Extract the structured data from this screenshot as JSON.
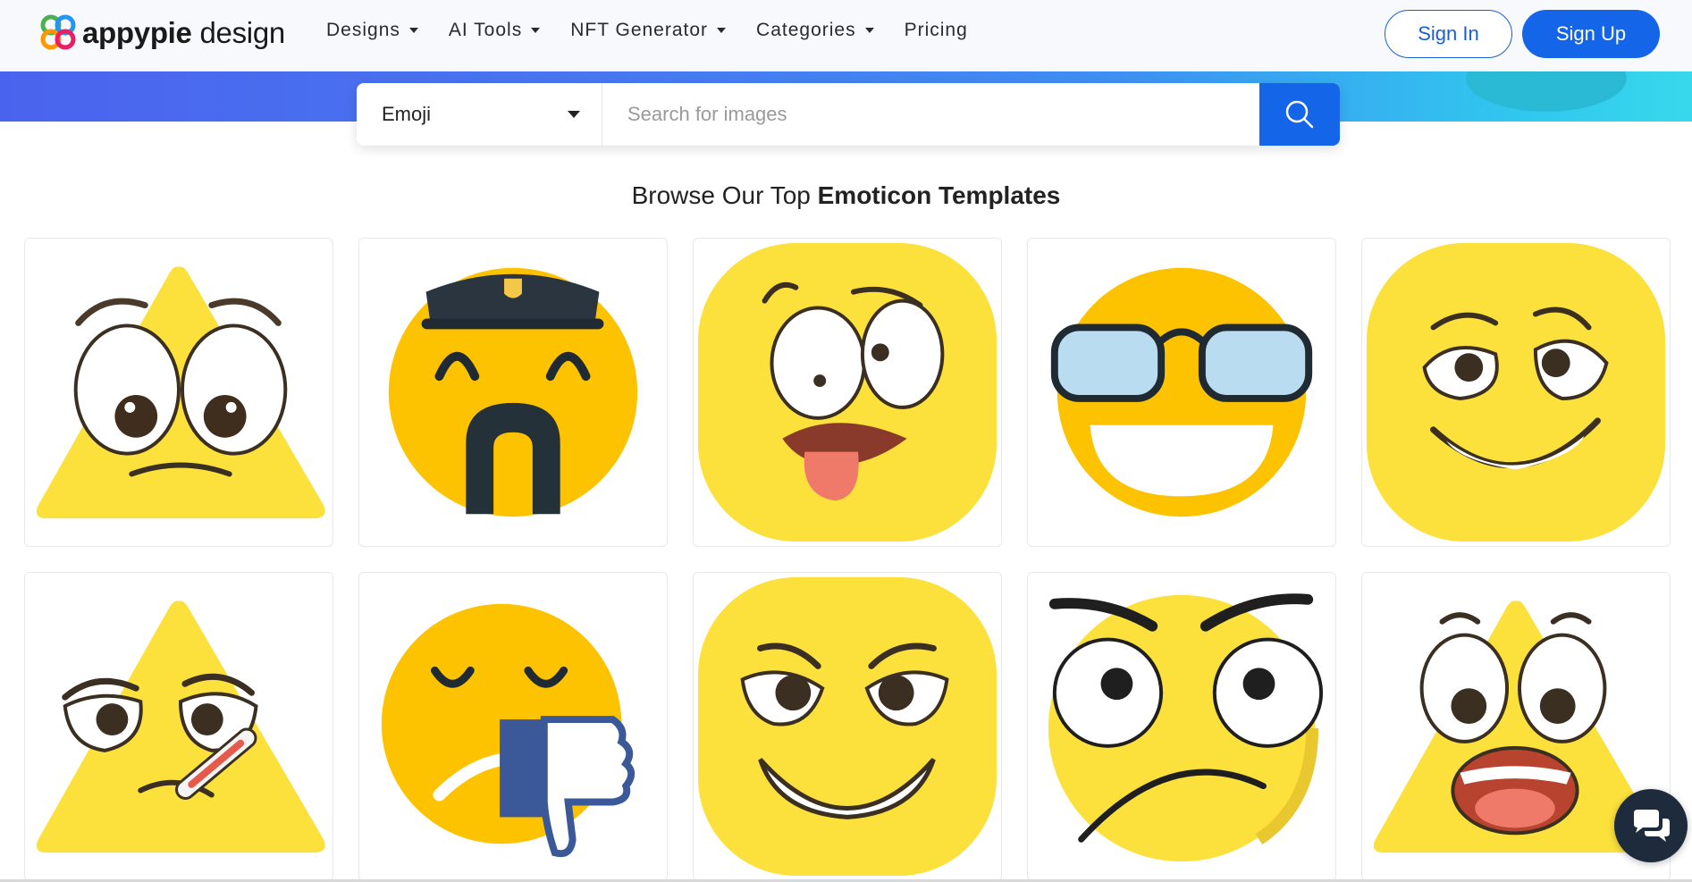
{
  "brand": {
    "name_bold": "appypie",
    "name_rest": " design"
  },
  "nav": [
    {
      "label": "Designs",
      "has_caret": true
    },
    {
      "label": "AI Tools",
      "has_caret": true
    },
    {
      "label": "NFT Generator",
      "has_caret": true
    },
    {
      "label": "Categories",
      "has_caret": true
    },
    {
      "label": "Pricing",
      "has_caret": false
    }
  ],
  "auth": {
    "signin_label": "Sign In",
    "signup_label": "Sign Up"
  },
  "search": {
    "category": "Emoji",
    "placeholder": "Search for images"
  },
  "heading": {
    "prefix": "Browse Our Top ",
    "emphasis": "Emoticon Templates"
  },
  "templates": [
    {
      "name": "triangle-surprised-emoji"
    },
    {
      "name": "police-cap-emoji"
    },
    {
      "name": "tongue-out-emoji"
    },
    {
      "name": "sunglasses-grin-emoji"
    },
    {
      "name": "smirk-emoji"
    },
    {
      "name": "triangle-sick-thermometer-emoji"
    },
    {
      "name": "thumbs-down-emoji"
    },
    {
      "name": "devilish-grin-emoji"
    },
    {
      "name": "angry-frown-emoji"
    },
    {
      "name": "triangle-shocked-emoji"
    }
  ],
  "colors": {
    "primary": "#1565e8",
    "emoji_yellow": "#fce03c",
    "emoji_orange": "#fdc200",
    "dark": "#1e2b3c"
  }
}
